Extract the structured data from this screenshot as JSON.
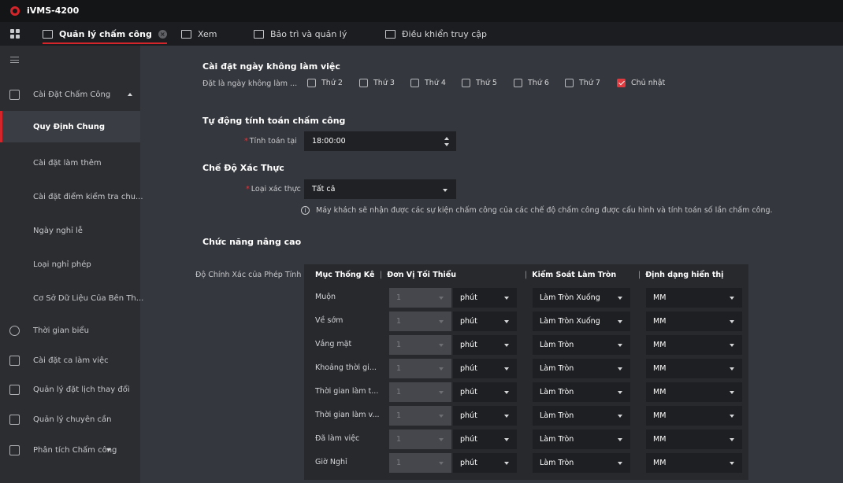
{
  "app": {
    "title": "iVMS-4200"
  },
  "tabs": [
    {
      "label": "Quản lý chấm công",
      "active": true,
      "icon": "calendar-icon"
    },
    {
      "label": "Xem",
      "icon": "camera-icon"
    },
    {
      "label": "Bảo trì và quản lý",
      "icon": "maintenance-icon"
    },
    {
      "label": "Điều khiển truy cập",
      "icon": "access-control-icon"
    }
  ],
  "sidebar": {
    "items": [
      {
        "label": "Cài Đặt Chấm Công",
        "icon": "calendar-icon",
        "expanded": true
      },
      {
        "label": "Quy Định Chung",
        "selected": true
      },
      {
        "label": "Cài đặt làm thêm"
      },
      {
        "label": "Cài đặt điểm kiểm tra chu..."
      },
      {
        "label": "Ngày nghỉ lễ"
      },
      {
        "label": "Loại nghỉ phép"
      },
      {
        "label": "Cơ Sở Dữ Liệu Của Bên Th..."
      },
      {
        "label": "Thời gian biểu",
        "icon": "clock-icon"
      },
      {
        "label": "Cài đặt ca làm việc",
        "icon": "shift-icon"
      },
      {
        "label": "Quản lý đặt lịch thay đổi",
        "icon": "schedule-icon"
      },
      {
        "label": "Quản lý chuyên cần",
        "icon": "attendance-icon"
      },
      {
        "label": "Phân tích Chấm công",
        "icon": "report-icon",
        "collapsed": true
      }
    ]
  },
  "nonwork": {
    "title": "Cài đặt ngày không làm việc",
    "label": "Đặt là ngày không làm ...",
    "days": [
      {
        "label": "Thứ 2",
        "checked": false
      },
      {
        "label": "Thứ 3",
        "checked": false
      },
      {
        "label": "Thứ 4",
        "checked": false
      },
      {
        "label": "Thứ 5",
        "checked": false
      },
      {
        "label": "Thứ 6",
        "checked": false
      },
      {
        "label": "Thứ 7",
        "checked": false
      },
      {
        "label": "Chủ nhật",
        "checked": true
      }
    ]
  },
  "auto_calc": {
    "title": "Tự động tính toán chấm công",
    "label": "Tính toán tại",
    "value": "18:00:00"
  },
  "auth_mode": {
    "title": "Chế Độ Xác Thực",
    "label": "Loại xác thực",
    "value": "Tất cả",
    "info": "Máy khách sẽ nhận được các sự kiện chấm công của các chế độ chấm công được cấu hình và tính toán số lần chấm công."
  },
  "advanced": {
    "title": "Chức năng nâng cao",
    "precision_label": "Độ Chính Xác của Phép Tính",
    "headers": [
      "Mục Thống Kê",
      "Đơn Vị Tối Thiểu",
      "Kiểm Soát Làm Tròn",
      "Định dạng hiển thị"
    ],
    "rows": [
      {
        "item": "Muộn",
        "min": "1",
        "unit": "phút",
        "round": "Làm Tròn Xuống",
        "format": "MM"
      },
      {
        "item": "Về sớm",
        "min": "1",
        "unit": "phút",
        "round": "Làm Tròn Xuống",
        "format": "MM"
      },
      {
        "item": "Vắng mặt",
        "min": "1",
        "unit": "phút",
        "round": "Làm Tròn",
        "format": "MM"
      },
      {
        "item": "Khoảng thời gi...",
        "min": "1",
        "unit": "phút",
        "round": "Làm Tròn",
        "format": "MM"
      },
      {
        "item": "Thời gian làm t...",
        "min": "1",
        "unit": "phút",
        "round": "Làm Tròn",
        "format": "MM"
      },
      {
        "item": "Thời gian làm v...",
        "min": "1",
        "unit": "phút",
        "round": "Làm Tròn",
        "format": "MM"
      },
      {
        "item": "Đã làm việc",
        "min": "1",
        "unit": "phút",
        "round": "Làm Tròn",
        "format": "MM"
      },
      {
        "item": "Giờ Nghỉ",
        "min": "1",
        "unit": "phút",
        "round": "Làm Tròn",
        "format": "MM"
      }
    ]
  },
  "colors": {
    "accent": "#d3252a",
    "background": "#34373d",
    "sidebar": "#2b2d31",
    "titlebar": "#141517"
  }
}
